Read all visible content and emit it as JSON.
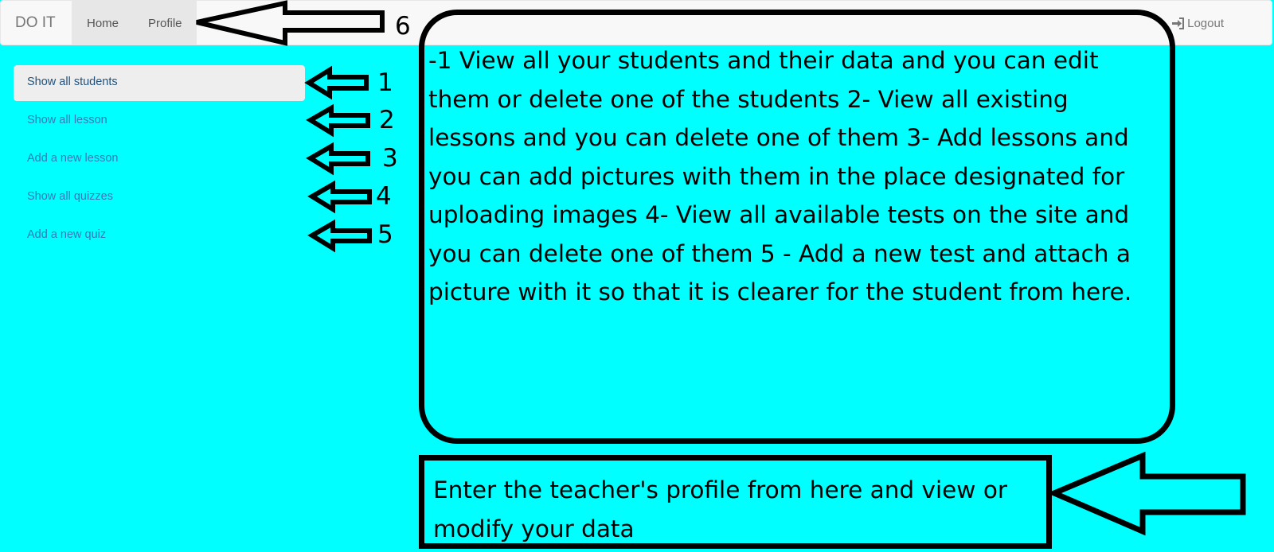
{
  "navbar": {
    "brand": "DO IT",
    "links": [
      "Home",
      "Profile"
    ],
    "logout_label": "Logout",
    "logout_icon": "sign-in-icon"
  },
  "sidebar": {
    "items": [
      {
        "label": "Show all students",
        "active": true
      },
      {
        "label": "Show all lesson",
        "active": false
      },
      {
        "label": "Add a new lesson",
        "active": false
      },
      {
        "label": "Show all quizzes",
        "active": false
      },
      {
        "label": "Add a new quiz",
        "active": false
      }
    ]
  },
  "annotations": {
    "numbers": [
      "1",
      "2",
      "3",
      "4",
      "5",
      "6"
    ],
    "main_callout": "-1 View all your students and their data and you can edit them or delete one of the students 2- View all existing lessons and you can delete one of them 3- Add lessons and you can add pictures with them in the place designated for uploading images 4- View all available tests on the site and you can delete one of them 5 - Add a new test and attach a picture with it so that it is clearer for the student from here.",
    "profile_callout": "Enter the teacher's profile from here and view or modify your data"
  },
  "colors": {
    "background": "#00ffff",
    "navbar": "#f8f8f8",
    "link": "#337ab7",
    "annotation": "#000000"
  }
}
